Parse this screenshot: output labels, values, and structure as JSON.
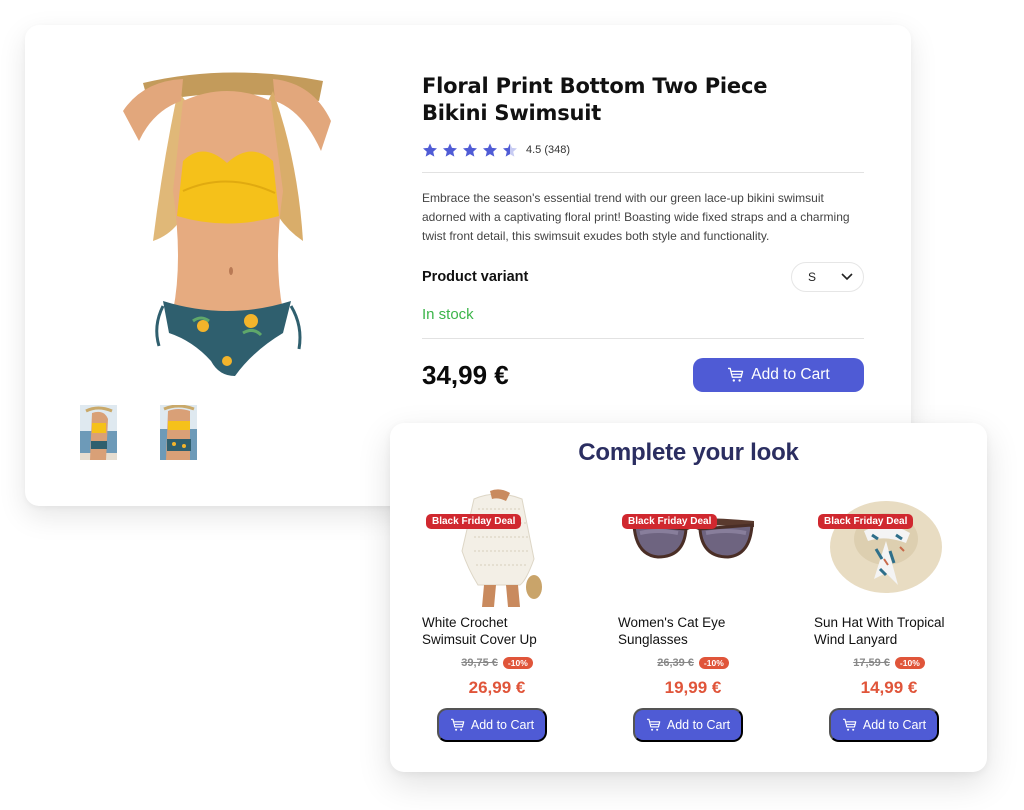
{
  "product": {
    "title_line1": "Floral Print Bottom Two Piece",
    "title_line2": "Bikini Swimsuit",
    "rating": 4.5,
    "rating_text": "4.5 (348)",
    "review_count": 348,
    "rating_stars_max": 5,
    "description": "Embrace the season's essential trend with our green lace-up bikini swimsuit adorned with a captivating floral print! Boasting wide fixed straps and a charming twist front detail, this swimsuit exudes both style and functionality.",
    "variant_label": "Product variant",
    "variant_selected": "S",
    "stock_status": "In stock",
    "price": "34,99 €",
    "add_to_cart_label": "Add to Cart",
    "main_image_alt": "Woman wearing yellow twist-front bikini top and teal floral bottom",
    "thumbnails": [
      {
        "alt": "Side view on beach"
      },
      {
        "alt": "Back view on beach"
      }
    ]
  },
  "colors": {
    "accent": "#4f5bd5",
    "star": "#4f5bd5",
    "in_stock": "#3cb54a",
    "sale": "#e0553a",
    "deal_badge": "#d0282f",
    "look_title": "#2b2e61"
  },
  "complete_look": {
    "title": "Complete your look",
    "items": [
      {
        "badge": "Black Friday Deal",
        "name_line1": "White Crochet",
        "name_line2": "Swimsuit Cover Up",
        "old_price": "39,75 €",
        "discount": "-10%",
        "price": "26,99 €",
        "add_to_cart_label": "Add to Cart"
      },
      {
        "badge": "Black Friday Deal",
        "name_line1": "Women's Cat Eye",
        "name_line2": "Sunglasses",
        "old_price": "26,39 €",
        "discount": "-10%",
        "price": "19,99 €",
        "add_to_cart_label": "Add to Cart"
      },
      {
        "badge": "Black Friday Deal",
        "name_line1": "Sun Hat With Tropical",
        "name_line2": "Wind Lanyard",
        "old_price": "17,59 €",
        "discount": "-10%",
        "price": "14,99 €",
        "add_to_cart_label": "Add to Cart"
      }
    ]
  }
}
